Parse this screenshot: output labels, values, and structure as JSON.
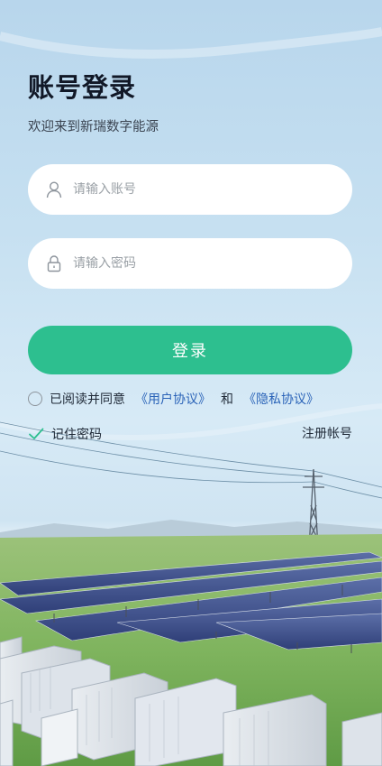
{
  "login": {
    "title": "账号登录",
    "subtitle": "欢迎来到新瑞数字能源",
    "username": {
      "placeholder": "请输入账号",
      "value": "",
      "icon": "user-icon"
    },
    "password": {
      "placeholder": "请输入密码",
      "value": "",
      "icon": "lock-icon"
    },
    "submit_label": "登录",
    "agreement": {
      "prefix": "已阅读并同意",
      "user_agreement": "《用户协议》",
      "conjunction": "和",
      "privacy_policy": "《隐私协议》",
      "checked": false
    },
    "remember": {
      "label": "记住密码",
      "checked": true
    },
    "register_label": "注册帐号"
  },
  "colors": {
    "accent": "#2dbf8f",
    "link": "#2a63b8",
    "title": "#111827"
  }
}
